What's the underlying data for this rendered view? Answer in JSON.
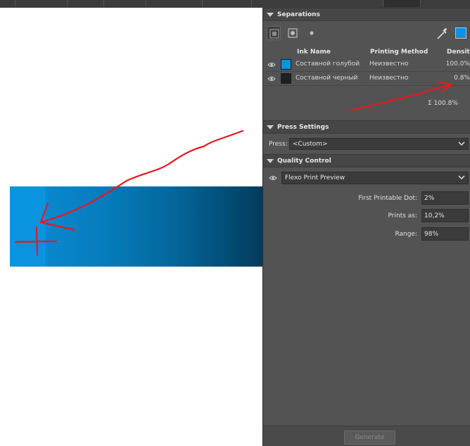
{
  "separations": {
    "title": "Separations",
    "columns": {
      "ink_name": "Ink Name",
      "printing_method": "Printing Method",
      "density": "Density"
    },
    "inks": [
      {
        "name": "Составной голубой",
        "method": "Неизвестно",
        "density": "100.0%",
        "color": "#0a93df"
      },
      {
        "name": "Составной черный",
        "method": "Неизвестно",
        "density": "0.8%",
        "color": "#1f1f1f"
      }
    ],
    "total": "Σ  100.8%"
  },
  "press_settings": {
    "title": "Press Settings",
    "press_label": "Press:",
    "press_value": "<Custom>"
  },
  "quality_control": {
    "title": "Quality Control",
    "preview_value": "Flexo Print Preview",
    "first_printable_dot_label": "First Printable Dot:",
    "first_printable_dot_value": "2%",
    "prints_as_label": "Prints as:",
    "prints_as_value": "10,2%",
    "range_label": "Range:",
    "range_value": "98%"
  },
  "footer": {
    "generate_label": "Generate"
  },
  "colors": {
    "panel_bg": "#535353",
    "header_bg": "#464646",
    "annotation": "#e8181c",
    "cyan": "#0a93df"
  },
  "icons": [
    "eye-icon",
    "eyedropper-icon",
    "chevron-down-icon",
    "triangle-collapse-icon"
  ]
}
